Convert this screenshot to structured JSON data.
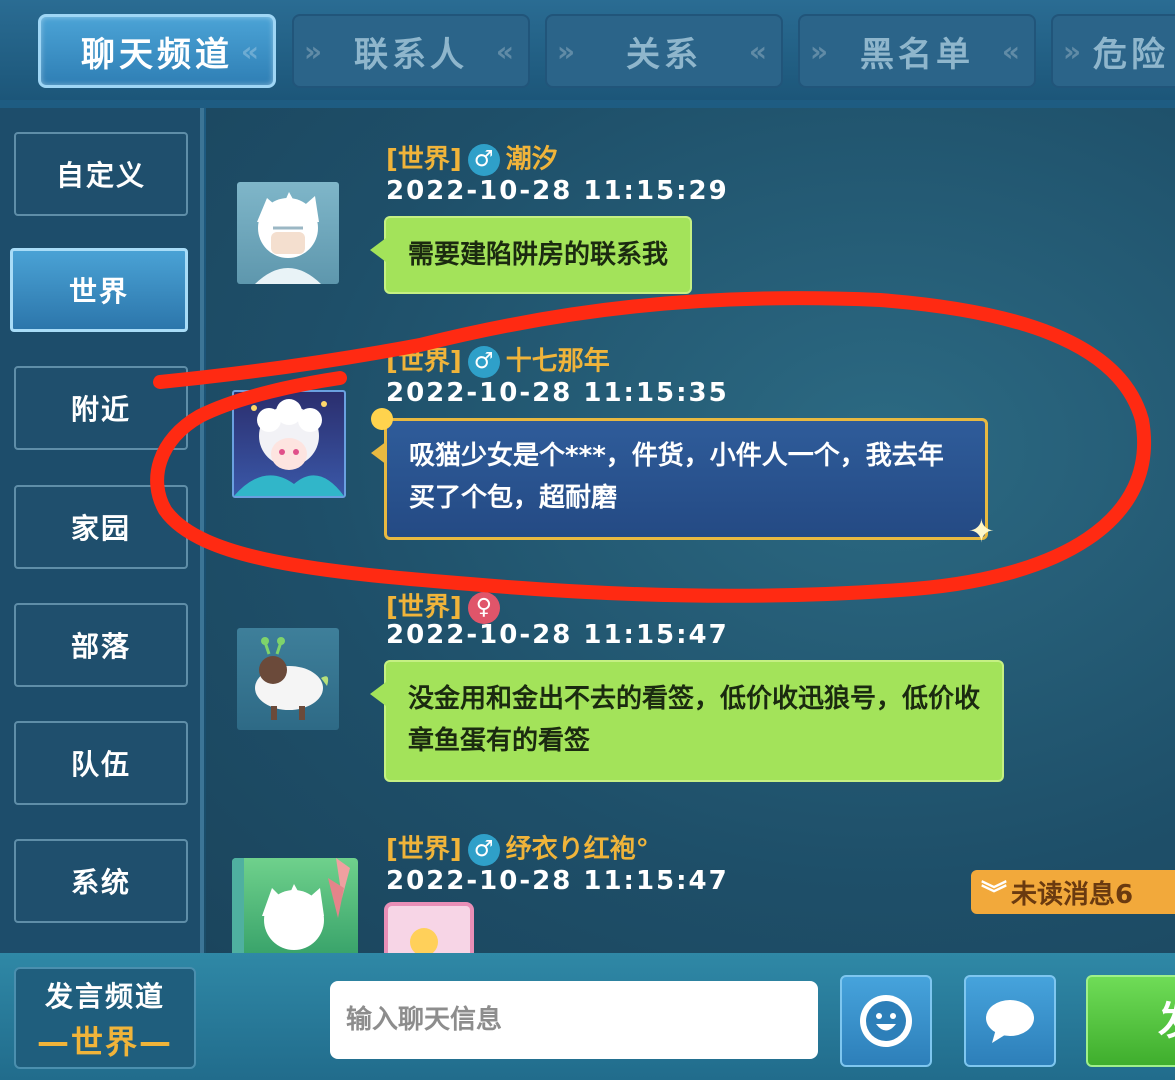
{
  "tabs": [
    {
      "label": "聊天频道",
      "active": true
    },
    {
      "label": "联系人",
      "active": false
    },
    {
      "label": "关系",
      "active": false
    },
    {
      "label": "黑名单",
      "active": false
    },
    {
      "label": "危险",
      "active": false
    }
  ],
  "sidebar": {
    "items": [
      {
        "label": "自定义",
        "active": false
      },
      {
        "label": "世界",
        "active": true
      },
      {
        "label": "附近",
        "active": false
      },
      {
        "label": "家园",
        "active": false
      },
      {
        "label": "部落",
        "active": false
      },
      {
        "label": "队伍",
        "active": false
      },
      {
        "label": "系统",
        "active": false
      }
    ]
  },
  "messages": [
    {
      "channel": "[世界]",
      "gender": "male",
      "name": "潮汐",
      "time": "2022-10-28  11:15:29",
      "text": "需要建陷阱房的联系我",
      "style": "green"
    },
    {
      "channel": "[世界]",
      "gender": "male",
      "name": "十七那年",
      "time": "2022-10-28  11:15:35",
      "text": "吸猫少女是个***，件货，小件人一个，我去年买了个包，超耐磨",
      "style": "blue"
    },
    {
      "channel": "[世界]",
      "gender": "female",
      "name": "",
      "time": "2022-10-28  11:15:47",
      "text": "没金用和金出不去的看签，低价收迅狼号，低价收章鱼蛋有的看签",
      "style": "green"
    },
    {
      "channel": "[世界]",
      "gender": "male",
      "name": "纾衣り红袍°",
      "time": "2022-10-28  11:15:47",
      "text": "",
      "style": "pink"
    }
  ],
  "unread": {
    "label": "未读消息6"
  },
  "bottom": {
    "speak_label": "发言频道",
    "speak_channel": "—世界—",
    "input_placeholder": "输入聊天信息",
    "send_label": "发"
  },
  "colors": {
    "accent_gold": "#f0b43a",
    "bubble_green": "#a3e35a",
    "bubble_blue": "#2f5c9a",
    "annotation_red": "#ff2a12"
  }
}
